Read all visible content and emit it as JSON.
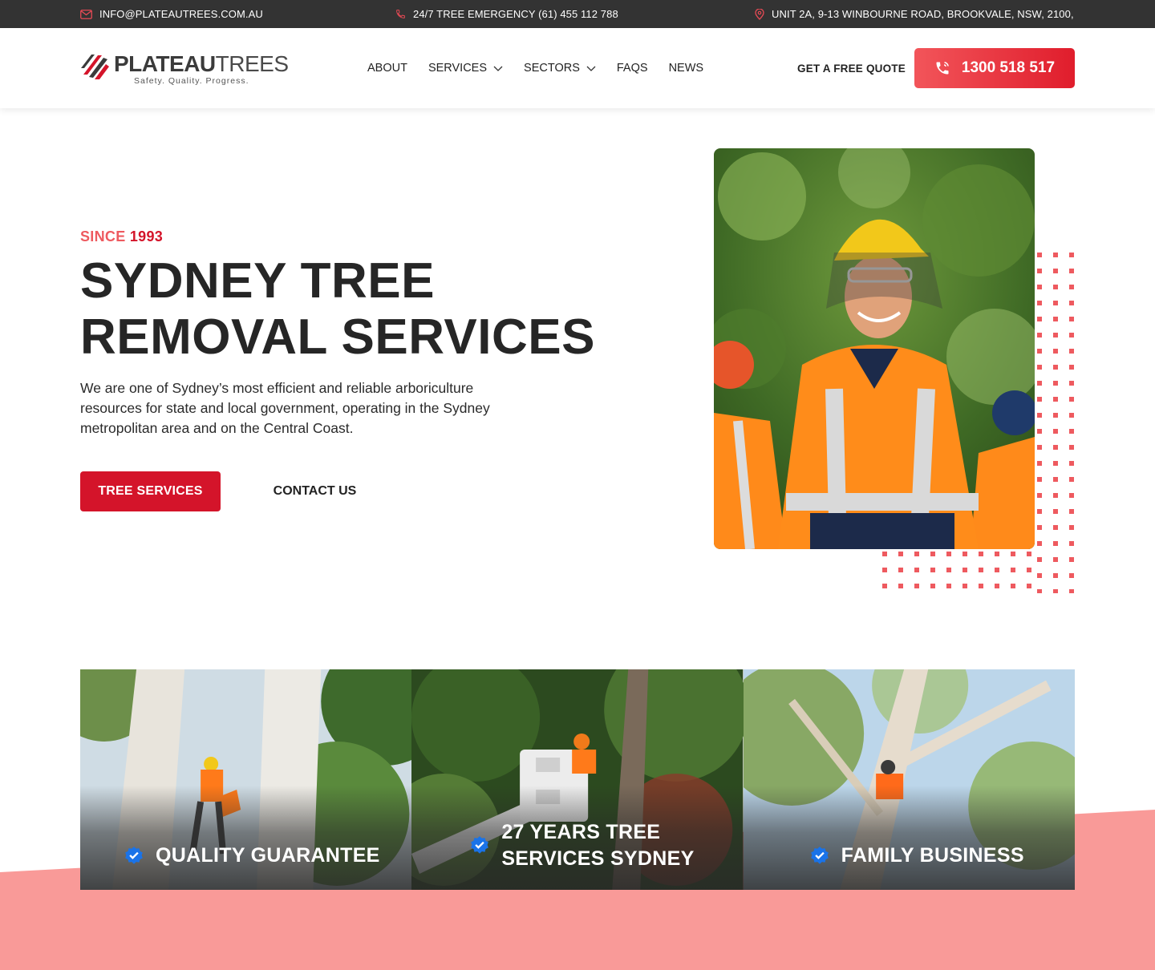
{
  "topbar": {
    "email": "INFO@PLATEAUTREES.COM.AU",
    "emergency": "24/7 TREE EMERGENCY (61) 455 112 788",
    "address": "UNIT 2A, 9-13 WINBOURNE ROAD, BROOKVALE, NSW, 2100,",
    "icons": [
      "mail-icon",
      "phone-icon",
      "location-pin-icon"
    ]
  },
  "header": {
    "logo": {
      "bold": "PLATEAU",
      "light": "TREES",
      "tagline": "Safety. Quality. Progress."
    },
    "nav": [
      {
        "label": "ABOUT",
        "dropdown": false
      },
      {
        "label": "SERVICES",
        "dropdown": true
      },
      {
        "label": "SECTORS",
        "dropdown": true
      },
      {
        "label": "FAQS",
        "dropdown": false
      },
      {
        "label": "NEWS",
        "dropdown": false
      }
    ],
    "quote_label": "GET A FREE QUOTE",
    "phone_label": "1300 518 517"
  },
  "hero": {
    "since_label": "SINCE",
    "since_year": "1993",
    "title_line1": "SYDNEY TREE",
    "title_line2": "REMOVAL SERVICES",
    "description": "We are one of Sydney’s most efficient and reliable arboriculture resources for state and local government, operating in the Sydney metropolitan area and on the Central Coast.",
    "primary_button": "TREE SERVICES",
    "secondary_button": "CONTACT US"
  },
  "features": [
    {
      "line1": "QUALITY GUARANTEE",
      "line2": ""
    },
    {
      "line1": "27 YEARS TREE",
      "line2": "SERVICES SYDNEY"
    },
    {
      "line1": "FAMILY BUSINESS",
      "line2": ""
    }
  ],
  "colors": {
    "topbar_bg": "#333333",
    "brand_red": "#d4142a",
    "accent_coral": "#ee5a5f",
    "pink_band": "#f99a98",
    "verified_blue": "#1a73e8",
    "heading": "#262626"
  }
}
